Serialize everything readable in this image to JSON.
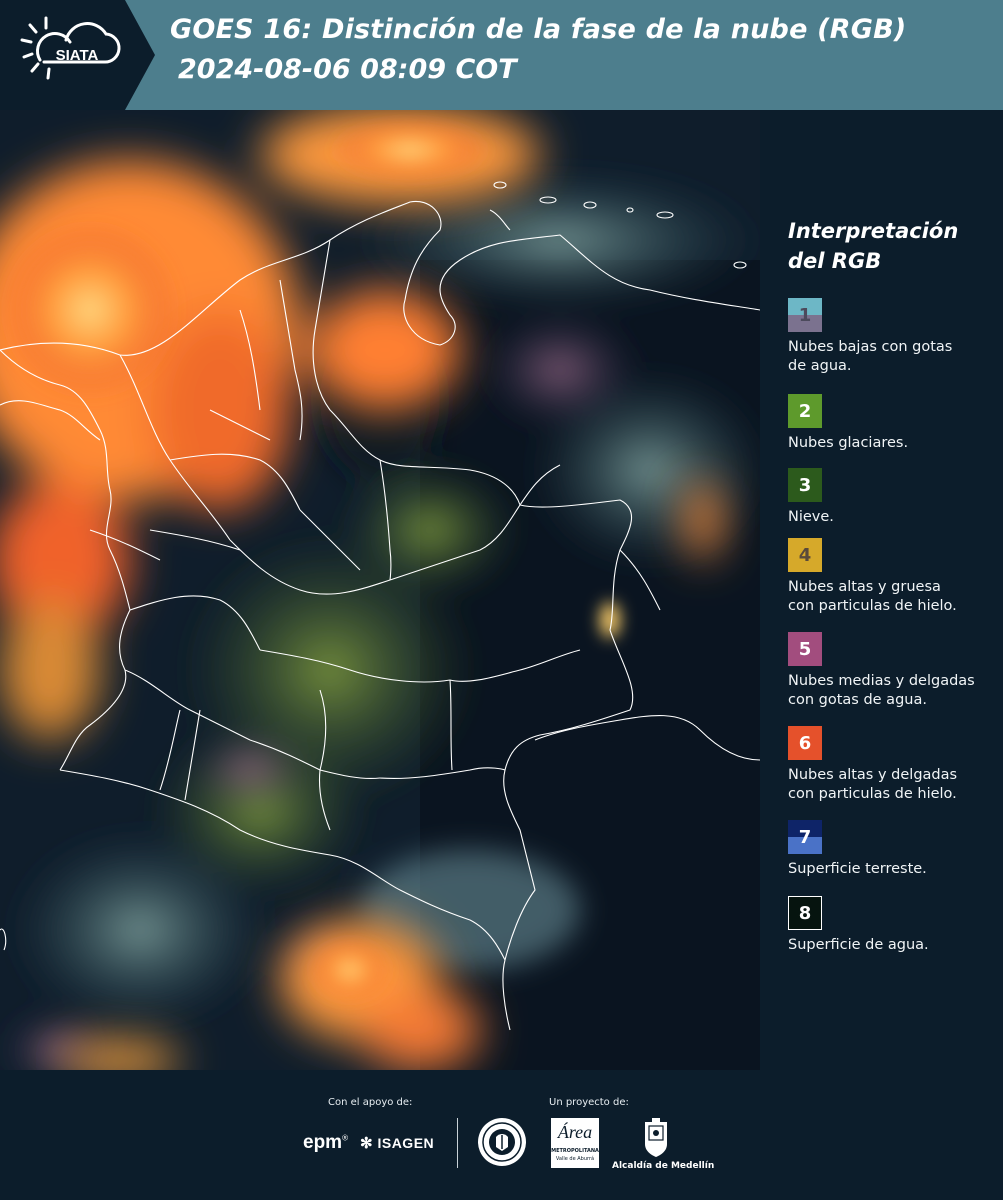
{
  "header": {
    "logo_text": "SIATA",
    "title_line1": "GOES 16: Distinción de la fase de la nube (RGB)",
    "title_line2": "2024-08-06 08:09 COT"
  },
  "legend": {
    "title_line1": "Interpretación",
    "title_line2": "del RGB",
    "items": [
      {
        "num": "1",
        "label_line1": "Nubes bajas con gotas",
        "label_line2": "de agua.",
        "color_top": "#6db7c6",
        "color_bottom": "#7b728f"
      },
      {
        "num": "2",
        "label_line1": "Nubes glaciares.",
        "label_line2": "",
        "color_top": "#5e9a2c",
        "color_bottom": "#5e9a2c"
      },
      {
        "num": "3",
        "label_line1": "Nieve.",
        "label_line2": "",
        "color_top": "#2c5a1c",
        "color_bottom": "#2c5a1c"
      },
      {
        "num": "4",
        "label_line1": "Nubes altas y gruesa",
        "label_line2": "con particulas de hielo.",
        "color_top": "#d6a92a",
        "color_bottom": "#d6a92a"
      },
      {
        "num": "5",
        "label_line1": "Nubes medias y delgadas",
        "label_line2": "con gotas de agua.",
        "color_top": "#a24d7e",
        "color_bottom": "#a24d7e"
      },
      {
        "num": "6",
        "label_line1": "Nubes altas y delgadas",
        "label_line2": "con particulas de hielo.",
        "color_top": "#e5512b",
        "color_bottom": "#e5512b"
      },
      {
        "num": "7",
        "label_line1": "Superficie terreste.",
        "label_line2": "",
        "color_top": "#0e2468",
        "color_bottom": "#4a72c7"
      },
      {
        "num": "8",
        "label_line1": "Superficie de agua.",
        "label_line2": "",
        "color_top": "#06140f",
        "color_bottom": "#06140f"
      }
    ]
  },
  "footer": {
    "support_caption": "Con el apoyo de:",
    "project_caption": "Un proyecto de:",
    "sponsor_epm": "epm",
    "sponsor_isagen": "ISAGEN",
    "area_logo": "Área",
    "area_sub1": "METROPOLITANA",
    "area_sub2": "Valle de Aburrá",
    "alcaldia": "Alcaldía de Medellín"
  }
}
